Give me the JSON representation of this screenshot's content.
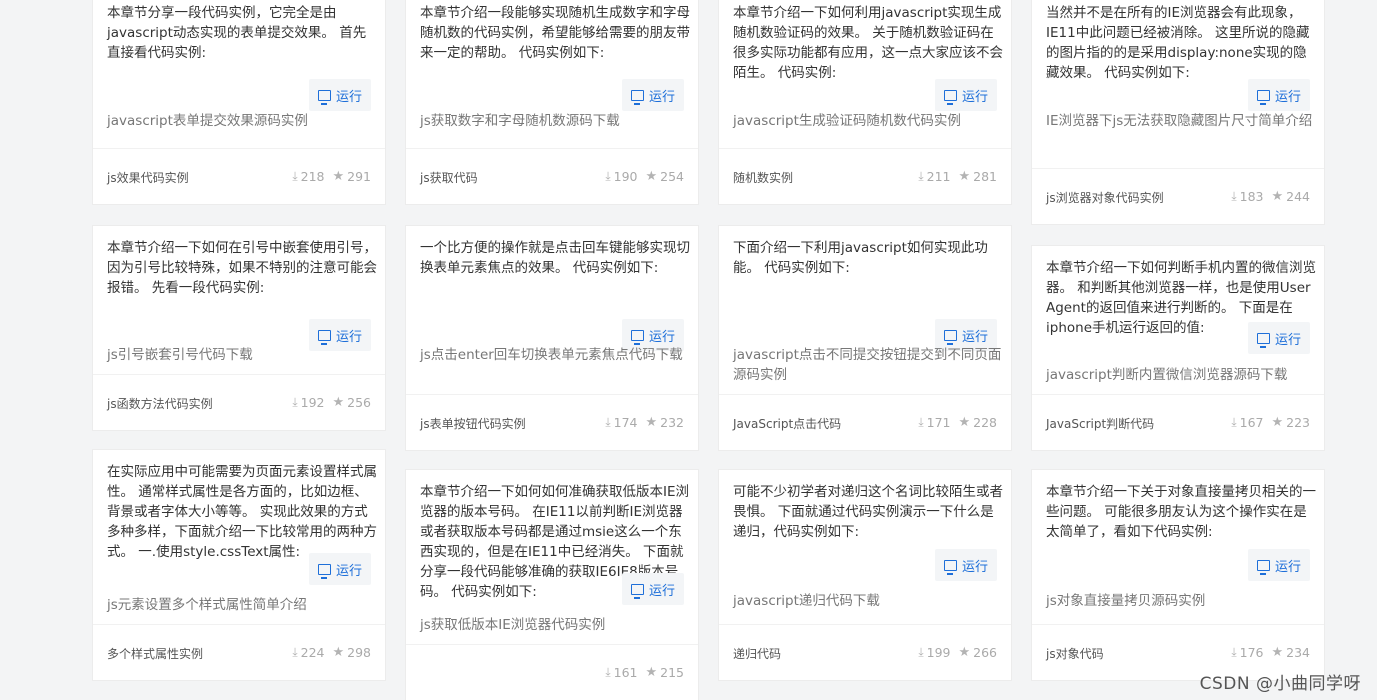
{
  "run_label": "运行",
  "columns": [
    [
      {
        "desc": "本章节分享一段代码实例，它完全是由javascript动态实现的表单提交效果。 首先直接看代码实例:",
        "link": "javascript表单提交效果源码实例",
        "tag": "js效果代码实例",
        "downloads": "218",
        "stars": "291"
      },
      {
        "desc": "本章节介绍一下如何在引号中嵌套使用引号，因为引号比较特殊，如果不特别的注意可能会报错。 先看一段代码实例:",
        "link": "js引号嵌套引号代码下载",
        "tag": "js函数方法代码实例",
        "downloads": "192",
        "stars": "256"
      },
      {
        "desc": "在实际应用中可能需要为页面元素设置样式属性。 通常样式属性是各方面的，比如边框、背景或者字体大小等等。 实现此效果的方式多种多样，下面就介绍一下比较常用的两种方式。 一.使用style.cssText属性:",
        "link": "js元素设置多个样式属性简单介绍",
        "tag": "多个样式属性实例",
        "downloads": "224",
        "stars": "298"
      }
    ],
    [
      {
        "desc": "本章节介绍一段能够实现随机生成数字和字母随机数的代码实例，希望能够给需要的朋友带来一定的帮助。 代码实例如下:",
        "link": "js获取数字和字母随机数源码下载",
        "tag": "js获取代码",
        "downloads": "190",
        "stars": "254"
      },
      {
        "desc": "一个比方便的操作就是点击回车键能够实现切换表单元素焦点的效果。 代码实例如下:",
        "link": "js点击enter回车切换表单元素焦点代码下载",
        "tag": "js表单按钮代码实例",
        "downloads": "174",
        "stars": "232"
      },
      {
        "desc": "本章节介绍一下如何如何准确获取低版本IE浏览器的版本号码。 在IE11以前判断IE浏览器或者获取版本号码都是通过msie这么一个东西实现的，但是在IE11中已经消失。 下面就分享一段代码能够准确的获取IE6IE8版本号码。 代码实例如下:",
        "link": "js获取低版本IE浏览器代码实例",
        "tag": "",
        "downloads": "161",
        "stars": "215"
      }
    ],
    [
      {
        "desc": "本章节介绍一下如何利用javascript实现生成随机数验证码的效果。 关于随机数验证码在很多实际功能都有应用，这一点大家应该不会陌生。 代码实例:",
        "link": "javascript生成验证码随机数代码实例",
        "tag": "随机数实例",
        "downloads": "211",
        "stars": "281"
      },
      {
        "desc": "下面介绍一下利用javascript如何实现此功能。 代码实例如下:",
        "link": "javascript点击不同提交按钮提交到不同页面源码实例",
        "tag": "JavaScript点击代码",
        "downloads": "171",
        "stars": "228"
      },
      {
        "desc": "可能不少初学者对递归这个名词比较陌生或者畏惧。 下面就通过代码实例演示一下什么是递归，代码实例如下:",
        "link": "javascript递归代码下载",
        "tag": "递归代码",
        "downloads": "199",
        "stars": "266"
      }
    ],
    [
      {
        "desc": "当然并不是在所有的IE浏览器会有此现象，IE11中此问题已经被消除。 这里所说的隐藏的图片指的的是采用display:none实现的隐藏效果。 代码实例如下:",
        "link": "IE浏览器下js无法获取隐藏图片尺寸简单介绍",
        "tag": "js浏览器对象代码实例",
        "downloads": "183",
        "stars": "244"
      },
      {
        "desc": "本章节介绍一下如何判断手机内置的微信浏览器。 和判断其他浏览器一样，也是使用User Agent的返回值来进行判断的。 下面是在iphone手机运行返回的值:",
        "link": "javascript判断内置微信浏览器源码下载",
        "tag": "JavaScript判断代码",
        "downloads": "167",
        "stars": "223"
      },
      {
        "desc": "本章节介绍一下关于对象直接量拷贝相关的一些问题。 可能很多朋友认为这个操作实在是太简单了，看如下代码实例:",
        "link": "js对象直接量拷贝源码实例",
        "tag": "js对象代码",
        "downloads": "176",
        "stars": "234"
      }
    ]
  ],
  "watermark": "CSDN @小曲同学呀"
}
